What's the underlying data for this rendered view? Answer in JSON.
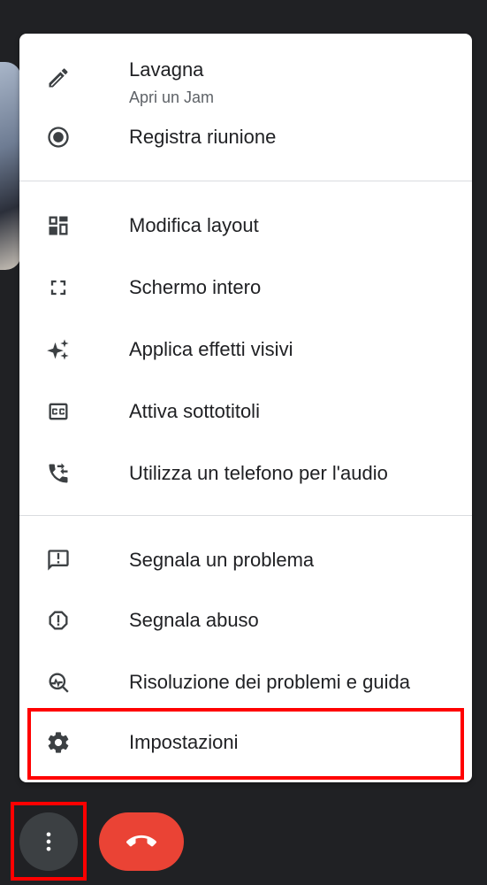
{
  "menu": {
    "items": [
      {
        "label": "Lavagna",
        "sublabel": "Apri un Jam",
        "icon": "pencil-icon"
      },
      {
        "label": "Registra riunione",
        "icon": "record-icon"
      },
      {
        "label": "Modifica layout",
        "icon": "layout-icon"
      },
      {
        "label": "Schermo intero",
        "icon": "fullscreen-icon"
      },
      {
        "label": "Applica effetti visivi",
        "icon": "sparkle-icon"
      },
      {
        "label": "Attiva sottotitoli",
        "icon": "closed-caption-icon"
      },
      {
        "label": "Utilizza un telefono per l'audio",
        "icon": "phone-forward-icon"
      },
      {
        "label": "Segnala un problema",
        "icon": "feedback-icon"
      },
      {
        "label": "Segnala abuso",
        "icon": "report-icon"
      },
      {
        "label": "Risoluzione dei problemi e guida",
        "icon": "troubleshoot-icon"
      },
      {
        "label": "Impostazioni",
        "icon": "settings-icon"
      }
    ]
  },
  "controls": {
    "more_icon": "more-vert-icon",
    "end_call_icon": "call-end-icon"
  },
  "colors": {
    "background": "#202124",
    "end_call": "#ea4335",
    "highlight": "#ff0000"
  }
}
